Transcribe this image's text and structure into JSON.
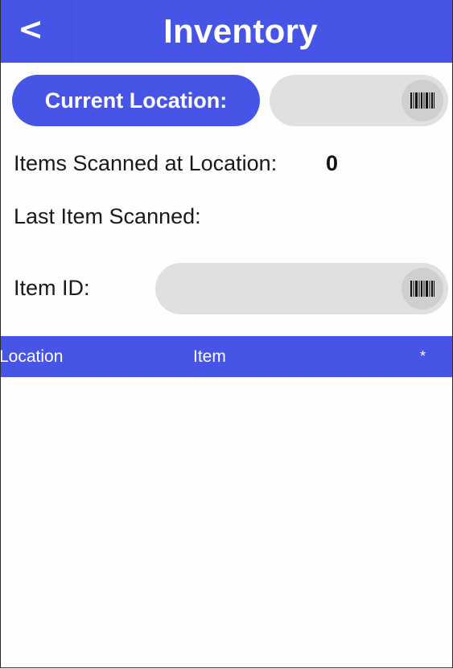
{
  "header": {
    "back_label": "<",
    "title": "Inventory"
  },
  "location": {
    "button_label": "Current Location:",
    "input_value": "",
    "scan_icon": "barcode-icon"
  },
  "stats": {
    "items_scanned_label": "Items Scanned at Location:",
    "items_scanned_value": "0",
    "last_item_label": "Last Item Scanned:",
    "last_item_value": ""
  },
  "item": {
    "label": "Item ID:",
    "input_value": "",
    "scan_icon": "barcode-icon"
  },
  "table": {
    "columns": [
      "Location",
      "Item",
      "*"
    ],
    "rows": []
  },
  "colors": {
    "accent": "#4755e6",
    "input_bg": "#e0e0df",
    "scan_button_bg": "#cfcfce"
  }
}
